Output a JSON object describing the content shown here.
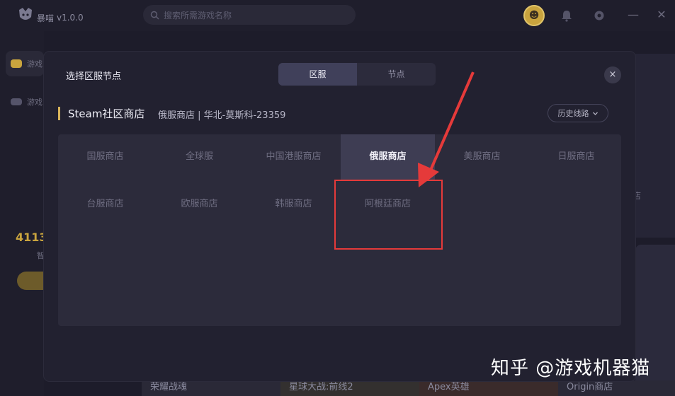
{
  "app": {
    "name": "暴喵",
    "version": "v1.0.0",
    "search_placeholder": "搜索所需游戏名称"
  },
  "sidebar": {
    "items": [
      {
        "label": "游戏",
        "active": true
      },
      {
        "label": "游戏",
        "active": false
      }
    ],
    "count": "4113",
    "sub": "智"
  },
  "background": {
    "right_text": "店",
    "games": [
      "荣耀战魂",
      "星球大战:前线2",
      "Apex英雄",
      "Origin商店"
    ]
  },
  "modal": {
    "title": "选择区服节点",
    "tabs": [
      {
        "label": "区服",
        "active": true
      },
      {
        "label": "节点",
        "active": false
      }
    ],
    "close": "×",
    "game_name": "Steam社区商店",
    "node_info": "俄服商店 | 华北-莫斯科-23359",
    "history_label": "历史线路",
    "regions": [
      [
        "国服商店",
        "全球服",
        "中国港服商店",
        "俄服商店",
        "美服商店",
        "日服商店"
      ],
      [
        "台服商店",
        "欧服商店",
        "韩服商店",
        "阿根廷商店"
      ]
    ],
    "selected_region": "俄服商店"
  },
  "watermark": "知乎 @游戏机器猫",
  "colors": {
    "accent_gold": "#d9b45a",
    "highlight_red": "#e53a3a",
    "selected_bg": "#3e3d53"
  }
}
